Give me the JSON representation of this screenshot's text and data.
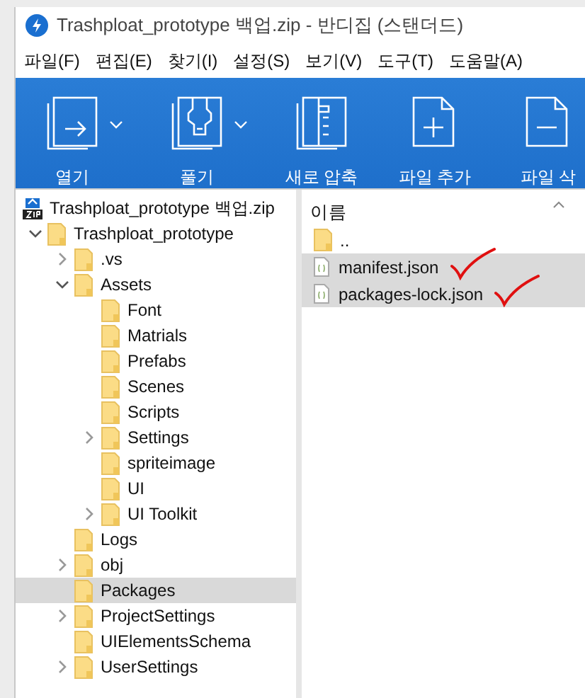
{
  "window": {
    "title": "Trashploat_prototype 백업.zip - 반디집 (스탠더드)"
  },
  "menu": [
    "파일(F)",
    "편집(E)",
    "찾기(I)",
    "설정(S)",
    "보기(V)",
    "도구(T)",
    "도움말(A)"
  ],
  "toolbar": [
    {
      "label": "열기",
      "kind": "open",
      "dropdown": true
    },
    {
      "label": "풀기",
      "kind": "extract",
      "dropdown": true
    },
    {
      "label": "새로 압축",
      "kind": "new",
      "dropdown": false
    },
    {
      "label": "파일 추가",
      "kind": "add",
      "dropdown": false
    },
    {
      "label": "파일 삭",
      "kind": "remove",
      "dropdown": false
    }
  ],
  "tree": {
    "archive": "Trashploat_prototype 백업.zip",
    "items": [
      {
        "label": "Trashploat_prototype",
        "has_children": true,
        "expanded": true,
        "selected": false,
        "children": [
          {
            "label": ".vs",
            "has_children": true,
            "expanded": false,
            "selected": false
          },
          {
            "label": "Assets",
            "has_children": true,
            "expanded": true,
            "selected": false,
            "children": [
              {
                "label": "Font",
                "has_children": false,
                "selected": false
              },
              {
                "label": "Matrials",
                "has_children": false,
                "selected": false
              },
              {
                "label": "Prefabs",
                "has_children": false,
                "selected": false
              },
              {
                "label": "Scenes",
                "has_children": false,
                "selected": false
              },
              {
                "label": "Scripts",
                "has_children": false,
                "selected": false
              },
              {
                "label": "Settings",
                "has_children": true,
                "expanded": false,
                "selected": false
              },
              {
                "label": "spriteimage",
                "has_children": false,
                "selected": false
              },
              {
                "label": "UI",
                "has_children": false,
                "selected": false
              },
              {
                "label": "UI Toolkit",
                "has_children": true,
                "expanded": false,
                "selected": false
              }
            ]
          },
          {
            "label": "Logs",
            "has_children": false,
            "selected": false
          },
          {
            "label": "obj",
            "has_children": true,
            "expanded": false,
            "selected": false
          },
          {
            "label": "Packages",
            "has_children": false,
            "selected": true
          },
          {
            "label": "ProjectSettings",
            "has_children": true,
            "expanded": false,
            "selected": false
          },
          {
            "label": "UIElementsSchema",
            "has_children": false,
            "selected": false
          },
          {
            "label": "UserSettings",
            "has_children": true,
            "expanded": false,
            "selected": false
          }
        ]
      }
    ]
  },
  "files": {
    "column": "이름",
    "rows": [
      {
        "name": "..",
        "kind": "folder",
        "selected": false,
        "marked": false
      },
      {
        "name": "manifest.json",
        "kind": "json",
        "selected": true,
        "marked": true
      },
      {
        "name": "packages-lock.json",
        "kind": "json",
        "selected": true,
        "marked": true
      }
    ]
  }
}
